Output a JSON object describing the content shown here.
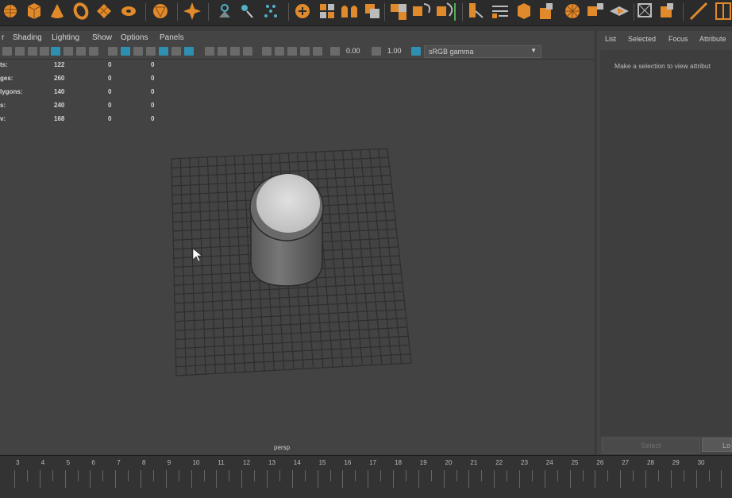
{
  "viewport_menu": [
    "r",
    "Shading",
    "Lighting",
    "Show",
    "Options",
    "Panels"
  ],
  "toolbar": {
    "exposure": "0.00",
    "gamma": "1.00",
    "colorspace": "sRGB gamma"
  },
  "hud": [
    {
      "label": "ts:",
      "v1": "122",
      "v2": "0",
      "v3": "0"
    },
    {
      "label": "ges:",
      "v1": "260",
      "v2": "0",
      "v3": "0"
    },
    {
      "label": "lygons:",
      "v1": "140",
      "v2": "0",
      "v3": "0"
    },
    {
      "label": "s:",
      "v1": "240",
      "v2": "0",
      "v3": "0"
    },
    {
      "label": "v:",
      "v1": "168",
      "v2": "0",
      "v3": "0"
    }
  ],
  "camera_name": "persp",
  "outliner": {
    "tabs": [
      "List",
      "Selected",
      "Focus",
      "Attribute"
    ],
    "message": "Make a selection to view attribut",
    "select_label": "Select",
    "load_label": "Lo"
  },
  "timeline": {
    "frames": [
      "3",
      "4",
      "5",
      "6",
      "7",
      "8",
      "9",
      "10",
      "11",
      "12",
      "13",
      "14",
      "15",
      "16",
      "17",
      "18",
      "19",
      "20",
      "21",
      "22",
      "23",
      "24",
      "25",
      "26",
      "27",
      "28",
      "29",
      "30"
    ]
  },
  "colors": {
    "shelf_icon": "#e08a2b",
    "accent_blue": "#2f8fb0"
  }
}
